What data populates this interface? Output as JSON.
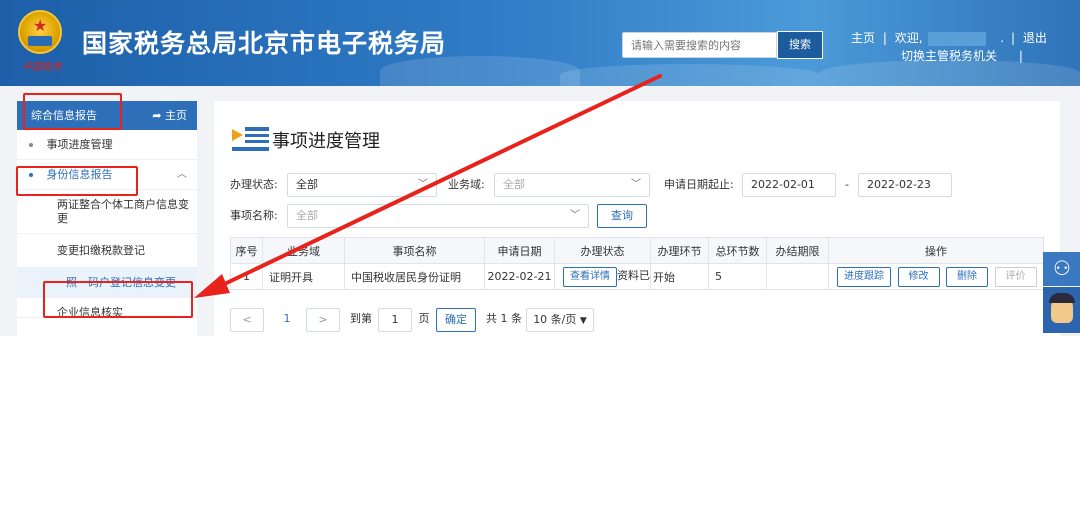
{
  "header": {
    "site_title": "国家税务总局北京市电子税务局",
    "emblem_mark": "中国税务",
    "search_placeholder": "请输入需要搜索的内容",
    "search_button": "搜索",
    "nav_home": "主页",
    "nav_welcome": "欢迎,",
    "nav_logout": "退出",
    "nav_switch": "切换主管税务机关",
    "separator": "|"
  },
  "sidebar": {
    "head_label": "综合信息报告",
    "home_label": "主页",
    "item_progress": "事项进度管理",
    "group_identity": "身份信息报告",
    "sub_items": [
      "两证整合个体工商户信息变更",
      "变更扣缴税款登记",
      "一照一码户登记信息变更",
      "企业信息核实"
    ]
  },
  "main": {
    "title": "事项进度管理",
    "filters": {
      "status_label": "办理状态:",
      "status_value": "全部",
      "domain_label": "业务域:",
      "domain_value": "全部",
      "date_label": "申请日期起止:",
      "date_from": "2022-02-01",
      "date_sep": "-",
      "date_to": "2022-02-23",
      "name_label": "事项名称:",
      "name_value": "全部",
      "query_button": "查询"
    },
    "table": {
      "headers": [
        "序号",
        "业务域",
        "事项名称",
        "申请日期",
        "办理状态",
        "办理环节",
        "总环节数",
        "办结期限",
        "操作"
      ],
      "rows": [
        {
          "index": "1",
          "domain": "证明开具",
          "name": "中国税收居民身份证明",
          "date": "2022-02-21",
          "status_btn": "查看详情",
          "status_text": "资料已保",
          "step": "开始",
          "total_steps": "5",
          "deadline": "",
          "actions": [
            "进度跟踪",
            "修改",
            "删除",
            "评价"
          ]
        }
      ]
    },
    "pager": {
      "prev": "<",
      "page": "1",
      "next": ">",
      "goto_label": "到第",
      "goto_value": "1",
      "page_unit": "页",
      "confirm": "确定",
      "total": "共 1 条",
      "page_size": "10 条/页"
    }
  },
  "colors": {
    "header_blue": "#2f7bc6",
    "primary": "#2d6fb8",
    "annotation_red": "#e8231c"
  }
}
